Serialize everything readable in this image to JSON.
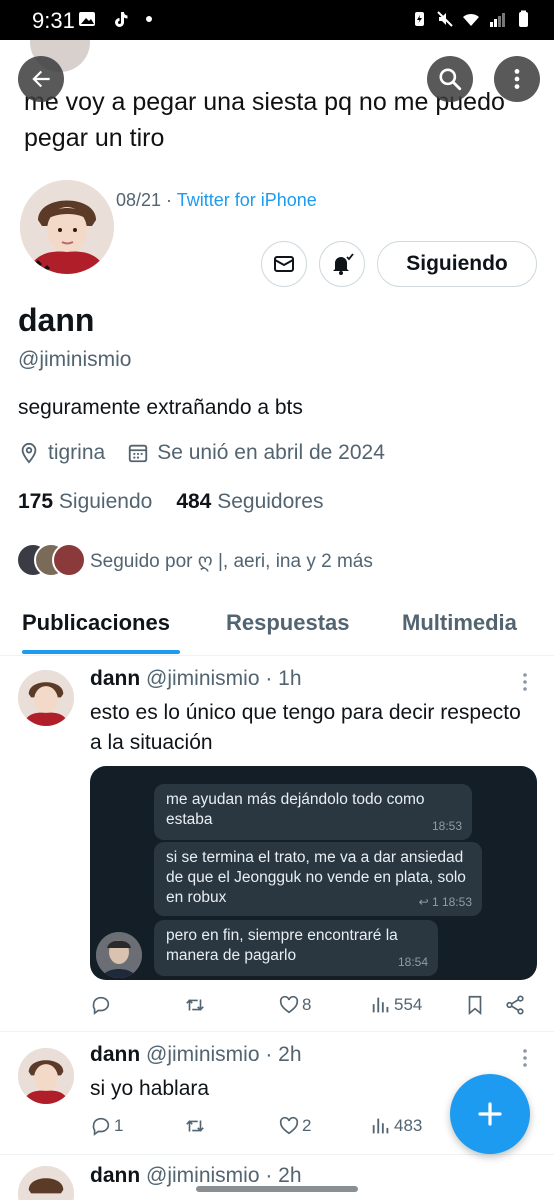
{
  "status_bar": {
    "time": "9:31"
  },
  "header": {
    "banner_text": "me voy a pegar una siesta pq no me puedo pegar un tiro",
    "meta_date": "08/21 · ",
    "meta_source": "Twitter for iPhone"
  },
  "profile": {
    "display_name": "dann",
    "handle": "@jiminismio",
    "bio": "seguramente extrañando a bts",
    "location": "tigrina",
    "joined": "Se unió en abril de 2024",
    "following_count": "175",
    "following_label": "Siguiendo",
    "followers_count": "484",
    "followers_label": "Seguidores",
    "followed_by": "Seguido por ღ |, aeri, ina y 2 más",
    "follow_button": "Siguiendo"
  },
  "tabs": [
    {
      "label": "Publicaciones",
      "active": true
    },
    {
      "label": "Respuestas",
      "active": false
    },
    {
      "label": "Multimedia",
      "active": false
    }
  ],
  "posts": [
    {
      "name": "dann",
      "meta": "@jiminismio · 1h",
      "text": "esto es lo único que tengo para decir respecto a la situación",
      "media_messages": [
        {
          "text": "me ayudan más dejándolo todo como estaba",
          "time": "18:53"
        },
        {
          "text": "si se termina el trato, me va a dar ansiedad de que el Jeongguk no vende en plata, solo en robux",
          "time": "↩ 1 18:53"
        },
        {
          "text": "pero en fin, siempre encontraré la manera de pagarlo",
          "time": "18:54"
        }
      ],
      "likes": "8",
      "views": "554"
    },
    {
      "name": "dann",
      "meta": "@jiminismio · 2h",
      "text": "si yo hablara",
      "replies": "1",
      "likes": "2",
      "views": "483"
    }
  ],
  "peek_post": {
    "name": "dann",
    "meta": "@jiminismio · 2h"
  },
  "colors": {
    "accent": "#1d9bf0",
    "text": "#0f1419",
    "muted": "#536471"
  },
  "icons": [
    "back-arrow-icon",
    "search-icon",
    "more-vertical-icon",
    "mail-icon",
    "bell-icon",
    "location-icon",
    "calendar-icon",
    "reply-icon",
    "retweet-icon",
    "heart-icon",
    "views-icon",
    "bookmark-icon",
    "share-icon",
    "plus-icon"
  ]
}
